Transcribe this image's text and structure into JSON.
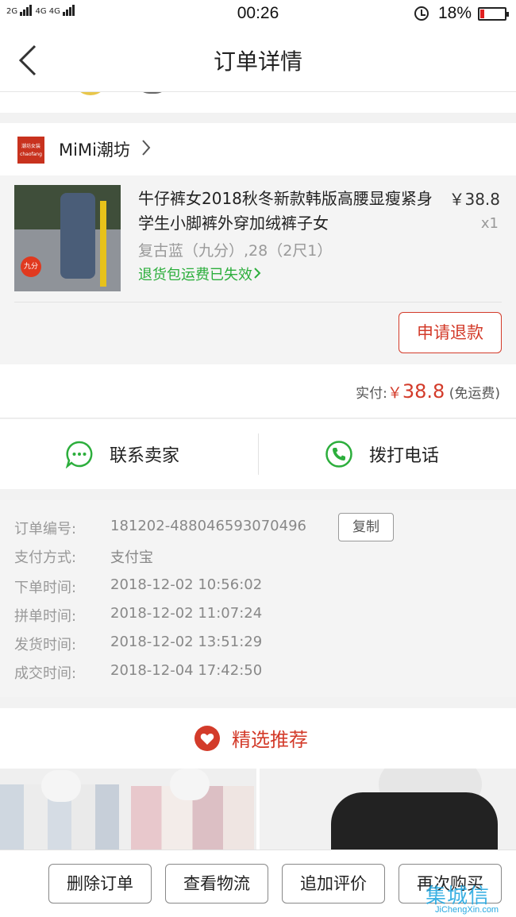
{
  "status_bar": {
    "network_1": "2G",
    "network_2": "4G 4G",
    "time": "00:26",
    "battery_percent": "18%",
    "battery_level": 0.18
  },
  "nav": {
    "title": "订单详情"
  },
  "shop": {
    "name": "MiMi潮坊",
    "logo_text_1": "潮坊女装",
    "logo_text_2": "chaofang"
  },
  "item": {
    "title": "牛仔裤女2018秋冬新款韩版高腰显瘦紧身学生小脚裤外穿加绒裤子女",
    "price": "￥38.8",
    "qty": "x1",
    "spec": "复古蓝（九分）,28（2尺1）",
    "return_note": "退货包运费已失效",
    "thumb_badge": "九分",
    "refund_button": "申请退款"
  },
  "paid": {
    "label": "实付:",
    "currency": "￥",
    "amount": "38.8",
    "note": "(免运费)"
  },
  "contact": {
    "seller": "联系卖家",
    "phone": "拨打电话"
  },
  "order_info": {
    "copy_button": "复制",
    "rows": [
      {
        "label": "订单编号:",
        "value": "181202-488046593070496"
      },
      {
        "label": "支付方式:",
        "value": "支付宝"
      },
      {
        "label": "下单时间:",
        "value": "2018-12-02 10:56:02"
      },
      {
        "label": "拼单时间:",
        "value": "2018-12-02 11:07:24"
      },
      {
        "label": "发货时间:",
        "value": "2018-12-02 13:51:29"
      },
      {
        "label": "成交时间:",
        "value": "2018-12-04 17:42:50"
      }
    ]
  },
  "recommend": {
    "title": "精选推荐"
  },
  "bottom_bar": {
    "delete": "删除订单",
    "logistics": "查看物流",
    "review": "追加评价",
    "rebuy": "再次购买"
  },
  "watermark": {
    "mark": "集城信",
    "url": "JiChengXin.com"
  },
  "colors": {
    "accent_red": "#d33b2a",
    "green": "#2cae3c"
  }
}
